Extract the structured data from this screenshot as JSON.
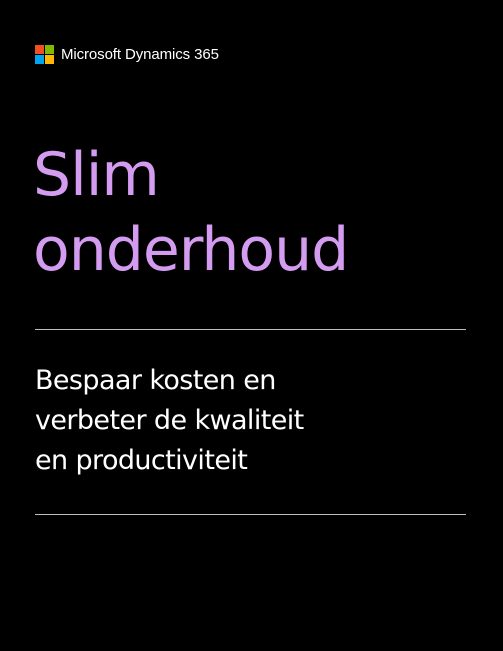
{
  "brand": {
    "name": "Microsoft Dynamics 365",
    "logo_colors": [
      "#f25022",
      "#7fba00",
      "#00a4ef",
      "#ffb900"
    ]
  },
  "title": {
    "lines": [
      "Slim",
      "onderhoud"
    ],
    "color": "#d49cf0"
  },
  "subtitle": {
    "lines": [
      "Bespaar kosten en",
      "verbeter de kwaliteit",
      "en productiviteit"
    ],
    "color": "#ffffff"
  },
  "background_color": "#000000"
}
